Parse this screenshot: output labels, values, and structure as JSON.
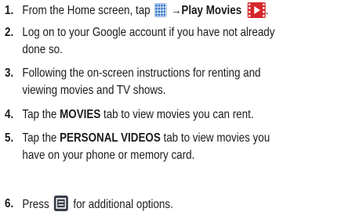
{
  "steps": [
    {
      "number": "1.",
      "text_before": "From the Home screen, tap ",
      "arrow": "→",
      "bold": "Play Movies",
      "text_after": ".",
      "icons": [
        "apps-grid-icon",
        "play-movies-icon"
      ]
    },
    {
      "number": "2.",
      "line1": "Log on to your Google account if you have not already",
      "line2": "done so."
    },
    {
      "number": "3.",
      "line1": "Following the on-screen instructions for renting and",
      "line2": "viewing movies and TV shows."
    },
    {
      "number": "4.",
      "text_before": "Tap the ",
      "bold": "MOVIES",
      "text_after": " tab to view movies you can rent."
    },
    {
      "number": "5.",
      "text_before": "Tap the ",
      "bold": "PERSONAL VIDEOS",
      "text_after": " tab to view movies you",
      "line2": "have on your phone or memory card."
    },
    {
      "number": "6.",
      "text_before": "Press ",
      "text_after": " for additional options.",
      "icons": [
        "menu-key-icon"
      ]
    }
  ],
  "colors": {
    "text": "#1a1a1a",
    "apps_icon": "#2f73c9",
    "play_movies_icon": "#d5262b",
    "menu_key_icon": "#3a3f4a"
  }
}
